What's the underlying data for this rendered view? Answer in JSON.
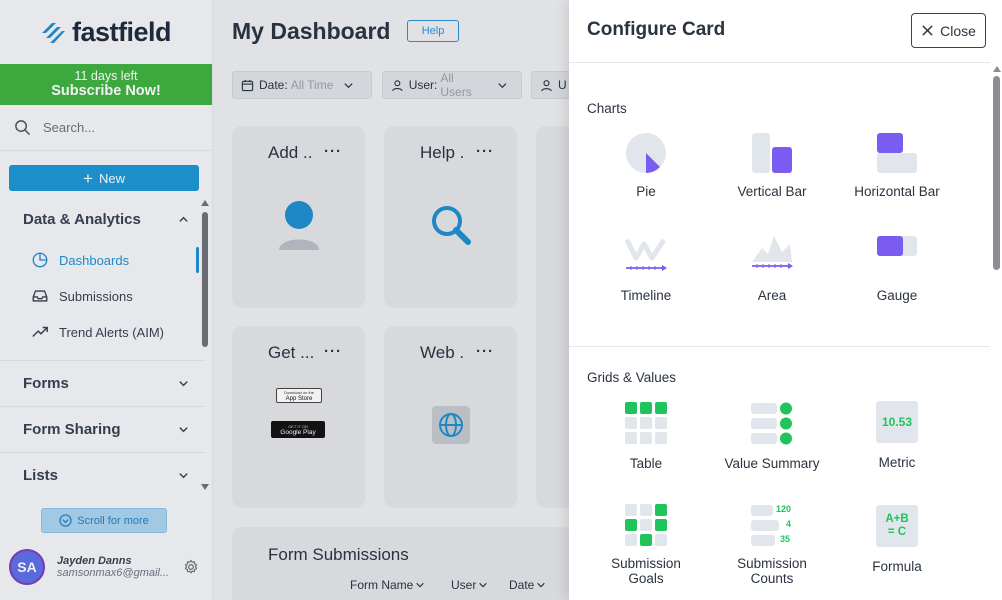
{
  "sidebar": {
    "logo_text": "fastfield",
    "trial_days": "11 days left",
    "trial_cta": "Subscribe Now!",
    "search_placeholder": "Search...",
    "new_label": "New",
    "sections": [
      {
        "label": "Data & Analytics",
        "expanded": true,
        "items": [
          {
            "label": "Dashboards",
            "icon": "pie-chart-icon",
            "active": true
          },
          {
            "label": "Submissions",
            "icon": "inbox-icon",
            "active": false
          },
          {
            "label": "Trend Alerts (AIM)",
            "icon": "trend-up-icon",
            "active": false
          }
        ]
      },
      {
        "label": "Forms",
        "expanded": false
      },
      {
        "label": "Form Sharing",
        "expanded": false
      },
      {
        "label": "Lists",
        "expanded": false
      }
    ],
    "scroll_more": "Scroll for more",
    "user": {
      "initials": "SA",
      "name": "Jayden Danns",
      "email": "samsonmax6@gmail..."
    }
  },
  "main": {
    "title": "My Dashboard",
    "help_label": "Help",
    "filters": [
      {
        "key": "Date:",
        "value": "All Time"
      },
      {
        "key": "User:",
        "value": "All Users"
      },
      {
        "key": "U",
        "value": ""
      }
    ],
    "cards": [
      {
        "title": "Add ..",
        "menu": "···"
      },
      {
        "title": "Help .",
        "menu": "···"
      },
      {
        "title": "Get ...",
        "menu": "···"
      },
      {
        "title": "Web .",
        "menu": "···"
      }
    ],
    "store_badges": {
      "apple": "App Store",
      "apple_small": "Download on the",
      "google": "Google Play",
      "google_small": "GET IT ON"
    },
    "form_submissions": {
      "title": "Form Submissions",
      "columns": [
        "Form Name",
        "User",
        "Date"
      ]
    }
  },
  "panel": {
    "title": "Configure Card",
    "close_label": "Close",
    "sections": [
      {
        "label": "Charts",
        "options": [
          {
            "label": "Pie",
            "icon": "pie-chart-icon"
          },
          {
            "label": "Vertical Bar",
            "icon": "vertical-bar-icon"
          },
          {
            "label": "Horizontal Bar",
            "icon": "horizontal-bar-icon"
          },
          {
            "label": "Timeline",
            "icon": "timeline-icon"
          },
          {
            "label": "Area",
            "icon": "area-chart-icon"
          },
          {
            "label": "Gauge",
            "icon": "gauge-icon"
          }
        ]
      },
      {
        "label": "Grids & Values",
        "options": [
          {
            "label": "Table",
            "icon": "table-icon"
          },
          {
            "label": "Value Summary",
            "icon": "value-summary-icon"
          },
          {
            "label": "Metric",
            "icon": "metric-icon",
            "icon_text": "10.53"
          },
          {
            "label": "Submission Goals",
            "label_lines": [
              "Submission",
              "Goals"
            ],
            "icon": "submission-goals-icon"
          },
          {
            "label": "Submission Counts",
            "label_lines": [
              "Submission",
              "Counts"
            ],
            "icon": "submission-counts-icon",
            "icon_values": [
              "120",
              "4",
              "35"
            ]
          },
          {
            "label": "Formula",
            "icon": "formula-icon",
            "icon_lines": [
              "A+B",
              "= C"
            ]
          }
        ]
      }
    ]
  },
  "colors": {
    "brand_blue": "#1c95d3",
    "trial_green": "#3fb13f",
    "accent_purple": "#7b5cf0",
    "accent_green": "#1fc45a",
    "icon_grey": "#e1e5ec"
  }
}
